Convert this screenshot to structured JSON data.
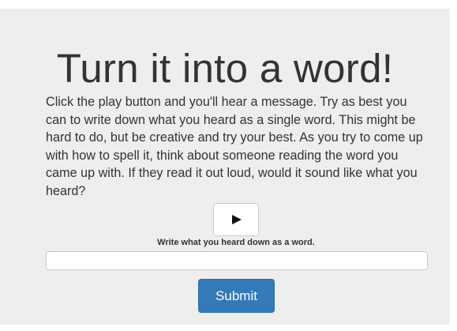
{
  "page": {
    "title": "Turn it into a word!",
    "instructions": "Click the play button and you'll hear a message. Try as best you can to write down what you heard as a single word. This might be hard to do, but be creative and try your best. As you try to come up with how to spell it, think about someone reading the word you came up with. If they read it out loud, would it sound like what you heard?"
  },
  "player": {
    "icon": "play-icon"
  },
  "form": {
    "label": "Write what you heard down as a word.",
    "input_value": "",
    "input_placeholder": "",
    "submit_label": "Submit"
  },
  "colors": {
    "panel_background": "#eeeeee",
    "text": "#333333",
    "submit_background": "#337ab7",
    "submit_text": "#ffffff"
  }
}
